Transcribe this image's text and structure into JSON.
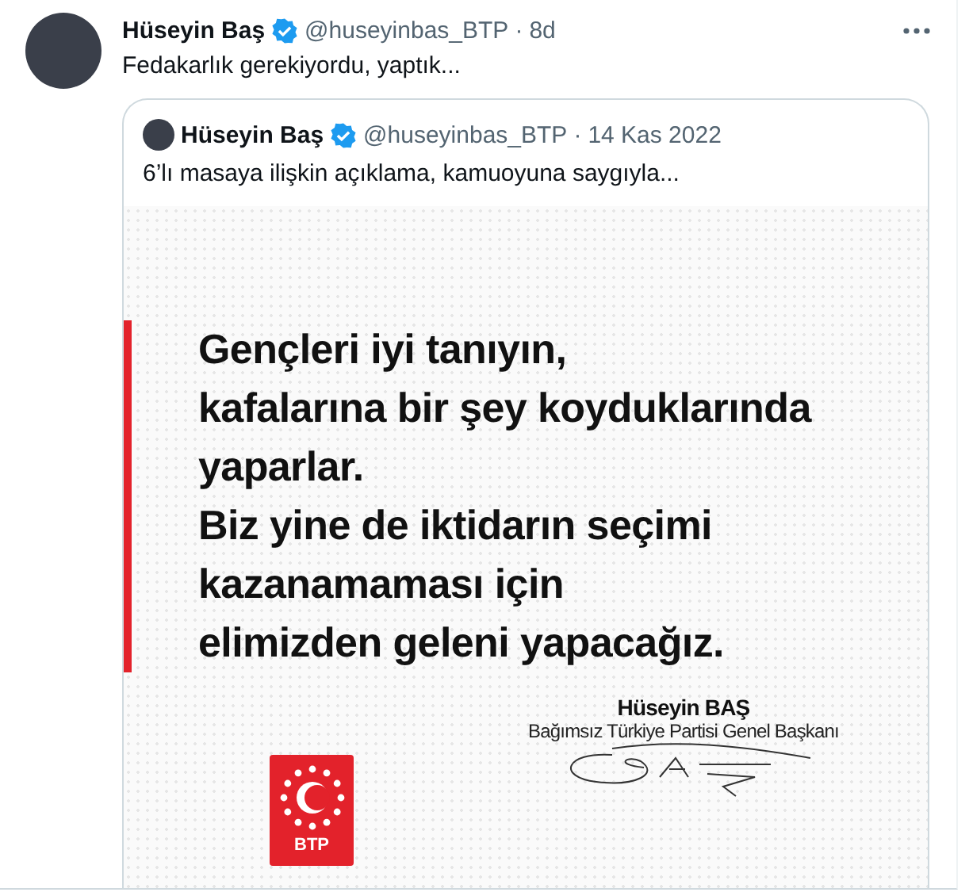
{
  "tweet": {
    "author": "Hüseyin Baş",
    "verified": true,
    "handle": "@huseyinbas_BTP",
    "separator": "·",
    "time": "8d",
    "text": "Fedakarlık gerekiyordu, yaptık...",
    "quote": {
      "author": "Hüseyin Baş",
      "verified": true,
      "handle": "@huseyinbas_BTP",
      "separator": "·",
      "time": "14 Kas 2022",
      "text": "6’lı masaya ilişkin açıklama, kamuoyuna saygıyla...",
      "image": {
        "statement_lines": [
          "Gençleri iyi tanıyın,",
          "kafalarına bir şey koyduklarında",
          "yaparlar.",
          "Biz yine de iktidarın seçimi",
          "kazanamaması için",
          "elimizden geleni yapacağız."
        ],
        "signer_name": "Hüseyin BAŞ",
        "signer_title": "Bağımsız Türkiye Partisi Genel Başkanı",
        "logo_text": "BTP"
      }
    }
  }
}
